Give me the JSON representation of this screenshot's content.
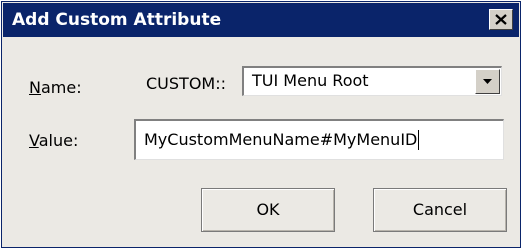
{
  "window": {
    "title": "Add Custom Attribute",
    "close_icon": "close-x-icon"
  },
  "form": {
    "name_label_accel": "N",
    "name_label_rest": "ame:",
    "prefix": "CUSTOM::",
    "name_value": "TUI Menu Root",
    "dropdown_icon": "chevron-down-icon",
    "value_label_accel": "V",
    "value_label_rest": "alue:",
    "value_text": "MyCustomMenuName#MyMenuID"
  },
  "buttons": {
    "ok": "OK",
    "cancel": "Cancel"
  },
  "colors": {
    "titlebar": "#0a246a",
    "dialog_bg": "#ebe9e4",
    "field_bg": "#ffffff"
  }
}
